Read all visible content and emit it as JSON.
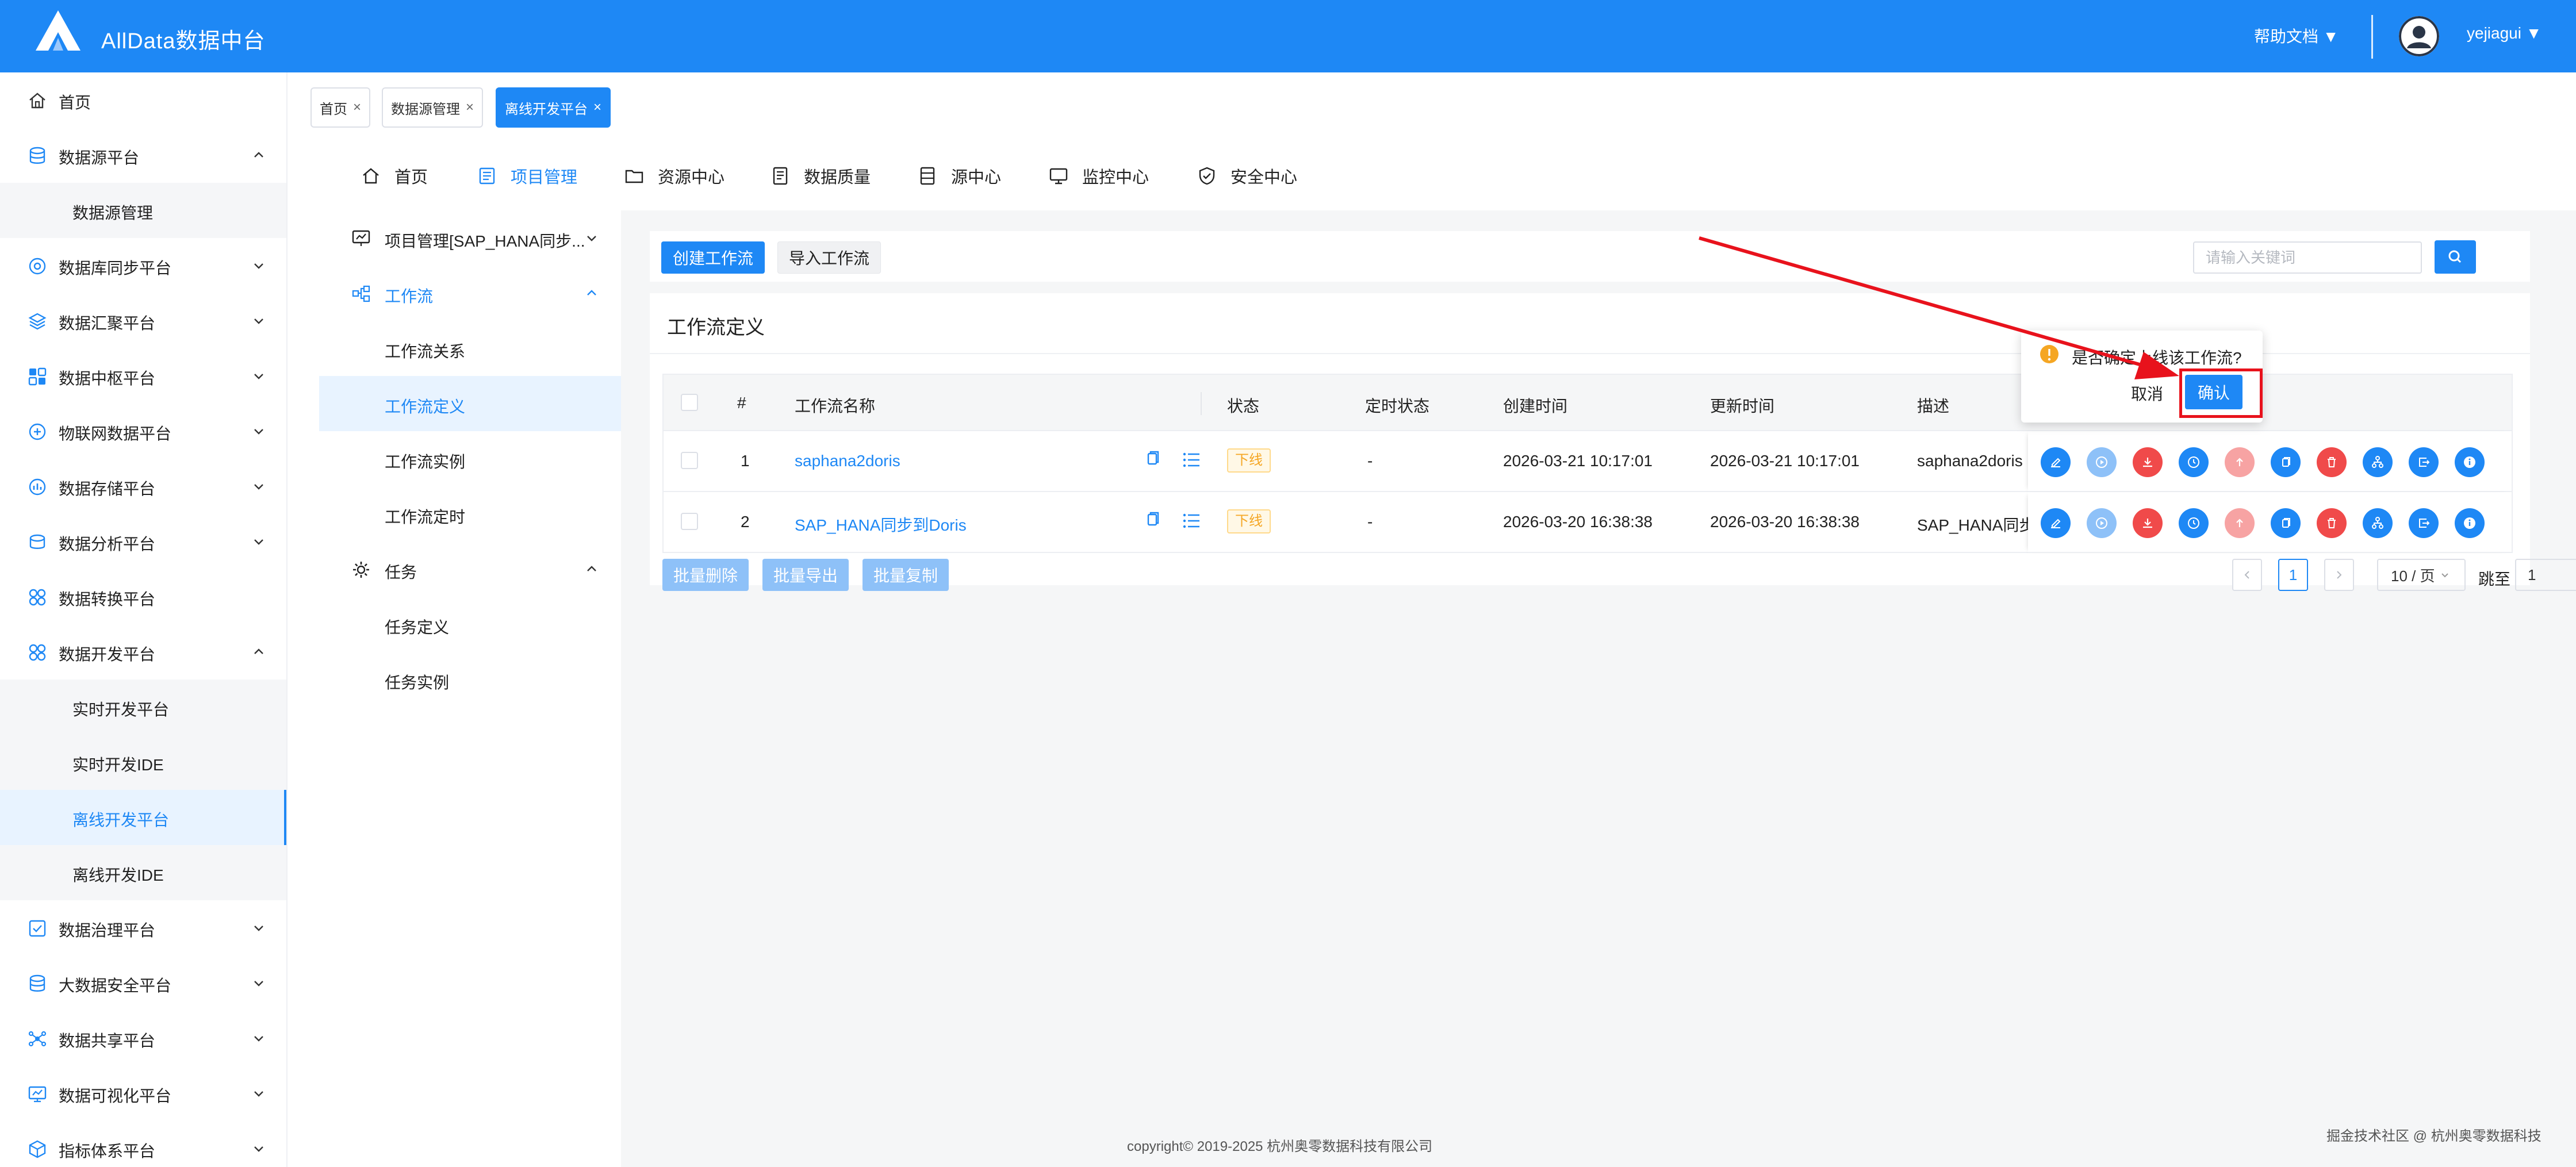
{
  "header": {
    "app_title": "AllData数据中台",
    "help_label": "帮助文档 ▼",
    "user_name": "yejiagui ▼"
  },
  "sidebar": {
    "items": [
      {
        "label": "首页",
        "icon": "home-icon"
      },
      {
        "label": "数据源平台",
        "icon": "database-icon",
        "expanded": true
      },
      {
        "label": "数据源管理",
        "sub": true
      },
      {
        "label": "数据库同步平台",
        "icon": "sync-icon"
      },
      {
        "label": "数据汇聚平台",
        "icon": "layers-icon"
      },
      {
        "label": "数据中枢平台",
        "icon": "hub-icon"
      },
      {
        "label": "物联网数据平台",
        "icon": "iot-icon"
      },
      {
        "label": "数据存储平台",
        "icon": "storage-icon"
      },
      {
        "label": "数据分析平台",
        "icon": "analysis-icon"
      },
      {
        "label": "数据转换平台",
        "icon": "transform-icon"
      },
      {
        "label": "数据开发平台",
        "icon": "develop-icon",
        "expanded": true
      },
      {
        "label": "实时开发平台",
        "sub": true
      },
      {
        "label": "实时开发IDE",
        "sub": true
      },
      {
        "label": "离线开发平台",
        "sub": true,
        "active": true
      },
      {
        "label": "离线开发IDE",
        "sub": true
      },
      {
        "label": "数据治理平台",
        "icon": "governance-icon"
      },
      {
        "label": "大数据安全平台",
        "icon": "security-db-icon"
      },
      {
        "label": "数据共享平台",
        "icon": "share-icon"
      },
      {
        "label": "数据可视化平台",
        "icon": "visual-icon"
      },
      {
        "label": "指标体系平台",
        "icon": "metrics-icon"
      }
    ]
  },
  "page_tabs": [
    {
      "label": "首页"
    },
    {
      "label": "数据源管理"
    },
    {
      "label": "离线开发平台",
      "active": true
    }
  ],
  "close_mark": "×",
  "top_nav": [
    {
      "label": "首页",
      "icon": "home-icon"
    },
    {
      "label": "项目管理",
      "icon": "project-icon",
      "active": true
    },
    {
      "label": "资源中心",
      "icon": "folder-icon"
    },
    {
      "label": "数据质量",
      "icon": "quality-icon"
    },
    {
      "label": "源中心",
      "icon": "source-icon"
    },
    {
      "label": "监控中心",
      "icon": "monitor-icon"
    },
    {
      "label": "安全中心",
      "icon": "shield-icon"
    }
  ],
  "sub_sidebar": {
    "project": "项目管理[SAP_HANA同步...",
    "workflow_group": "工作流",
    "workflow_items": [
      "工作流关系",
      "工作流定义",
      "工作流实例",
      "工作流定时"
    ],
    "task_group": "任务",
    "task_items": [
      "任务定义",
      "任务实例"
    ]
  },
  "toolbar": {
    "create_label": "创建工作流",
    "import_label": "导入工作流",
    "search_placeholder": "请输入关键词"
  },
  "panel": {
    "title": "工作流定义"
  },
  "table": {
    "columns": [
      "#",
      "工作流名称",
      "状态",
      "定时状态",
      "创建时间",
      "更新时间",
      "描述"
    ],
    "rows": [
      {
        "index": "1",
        "name": "saphana2doris",
        "status": "下线",
        "schedule": "-",
        "created": "2026-03-21 10:17:01",
        "updated": "2026-03-21 10:17:01",
        "desc": "saphana2doris"
      },
      {
        "index": "2",
        "name": "SAP_HANA同步到Doris",
        "status": "下线",
        "schedule": "-",
        "created": "2026-03-20 16:38:38",
        "updated": "2026-03-20 16:38:38",
        "desc": "SAP_HANA同步"
      }
    ]
  },
  "batch": {
    "delete": "批量删除",
    "export": "批量导出",
    "copy": "批量复制"
  },
  "pagination": {
    "current": "1",
    "page_size": "10 / 页",
    "jump_label": "跳至",
    "jump_value": "1"
  },
  "popconfirm": {
    "message": "是否确定上线该工作流?",
    "cancel": "取消",
    "confirm": "确认"
  },
  "footer": {
    "copyright": "copyright© 2019-2025 杭州奥零数据科技有限公司",
    "watermark": "掘金技术社区 @ 杭州奥零数据科技"
  },
  "colors": {
    "primary": "#1e88f5",
    "danger": "#f04a4a",
    "warning": "#f5a623",
    "annotation": "#e8121c"
  }
}
